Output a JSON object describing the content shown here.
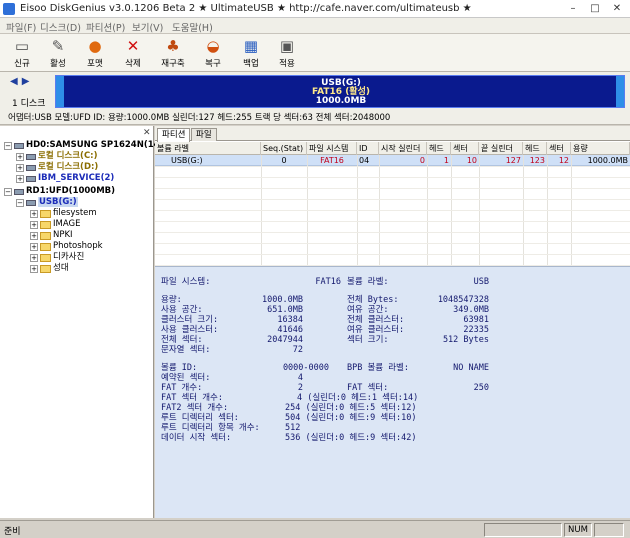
{
  "window": {
    "title": "Eisoo DiskGenius v3.0.1206 Beta 2 ★ UltimateUSB ★ http://cafe.naver.com/ultimateusb ★",
    "minimize": "–",
    "maximize": "□",
    "close": "✕"
  },
  "menu": [
    "파일(F)",
    "디스크(D)",
    "파티션(P)",
    "보기(V)",
    "도움말(H)"
  ],
  "toolbar": [
    {
      "label": "신규",
      "icon": "new-icon",
      "glyph": "▭",
      "color": "#555555"
    },
    {
      "label": "활성",
      "icon": "activate-icon",
      "glyph": "✎",
      "color": "#555555"
    },
    {
      "label": "포맷",
      "icon": "format-icon",
      "glyph": "●",
      "color": "#e06a10"
    },
    {
      "label": "삭제",
      "icon": "delete-icon",
      "glyph": "✕",
      "color": "#d01010"
    },
    {
      "label": "재구축",
      "icon": "rebuild-icon",
      "glyph": "♣",
      "color": "#c04a10"
    },
    {
      "label": "복구",
      "icon": "recover-icon",
      "glyph": "◒",
      "color": "#d05010"
    },
    {
      "label": "백업",
      "icon": "backup-icon",
      "glyph": "▦",
      "color": "#2a5ec0"
    },
    {
      "label": "적용",
      "icon": "apply-icon",
      "glyph": "▣",
      "color": "#555555"
    }
  ],
  "disk_bar": {
    "nav_prev": "◀",
    "nav_next": "▶",
    "disk_label": "1 디스크",
    "partition_name": "USB(G:)",
    "partition_fs": "FAT16 (활성)",
    "partition_size": "1000.0MB"
  },
  "info_line": "어댑터:USB 모델:UFD ID: 용량:1000.0MB 실린더:127 헤드:255 트랙 당 섹터:63 전체 섹터:2048000",
  "tree": {
    "close": "✕",
    "items": [
      {
        "text": "HD0:SAMSUNG SP1624N(149GB)",
        "style": "bold",
        "level": 0,
        "kind": "disk",
        "expander": "−"
      },
      {
        "text": "로컬 디스크(C:)",
        "style": "olive",
        "level": 1,
        "kind": "disk",
        "expander": "+"
      },
      {
        "text": "로컬 디스크(D:)",
        "style": "olive",
        "level": 1,
        "kind": "disk",
        "expander": "+"
      },
      {
        "text": "IBM_SERVICE(2)",
        "style": "blue",
        "level": 1,
        "kind": "disk",
        "expander": "+"
      },
      {
        "text": "RD1:UFD(1000MB)",
        "style": "bold",
        "level": 0,
        "kind": "disk",
        "expander": "−"
      },
      {
        "text": "USB(G:)",
        "style": "sel",
        "level": 1,
        "kind": "disk",
        "expander": "−"
      },
      {
        "text": "filesystem",
        "style": "",
        "level": 2,
        "kind": "folder",
        "expander": "+"
      },
      {
        "text": "IMAGE",
        "style": "",
        "level": 2,
        "kind": "folder",
        "expander": "+"
      },
      {
        "text": "NPKI",
        "style": "",
        "level": 2,
        "kind": "folder",
        "expander": "+"
      },
      {
        "text": "Photoshopk",
        "style": "",
        "level": 2,
        "kind": "folder",
        "expander": "+"
      },
      {
        "text": "디카사진",
        "style": "",
        "level": 2,
        "kind": "folder",
        "expander": "+"
      },
      {
        "text": "성대",
        "style": "",
        "level": 2,
        "kind": "folder",
        "expander": "+"
      }
    ]
  },
  "tabs": [
    "파티션",
    "파일"
  ],
  "table": {
    "headers": [
      "볼륨 라벨",
      "Seq.(Stat)",
      "파일 시스템",
      "ID",
      "시작 실린더",
      "헤드",
      "섹터",
      "끝 실린더",
      "헤드",
      "섹터",
      "용량"
    ],
    "row": [
      "USB(G:)",
      "0",
      "FAT16",
      "04",
      "0",
      "1",
      "10",
      "127",
      "123",
      "12",
      "1000.0MB"
    ]
  },
  "details": {
    "fs_label": "파일 시스템:",
    "fs_value": "FAT16",
    "vol_label": "볼륨 라벨:",
    "vol_value": "USB",
    "capacity_label": "용량:",
    "capacity_value": "1000.0MB",
    "total_label": "전체 Bytes:",
    "total_value": "1048547328",
    "used_label": "사용 공간:",
    "used_value": "651.0MB",
    "free_label": "여유 공간:",
    "free_value": "349.0MB",
    "cluster_size_label": "클러스터 크기:",
    "cluster_size_value": "16384",
    "total_clusters_label": "전체 클러스터:",
    "total_clusters_value": "63981",
    "used_clusters_label": "사용 클러스터:",
    "used_clusters_value": "41646",
    "free_clusters_label": "여유 클러스터:",
    "free_clusters_value": "22335",
    "total_sectors_label": "전체 섹터:",
    "total_sectors_value": "2047944",
    "sector_size_label": "섹터 크기:",
    "sector_size_value": "512 Bytes",
    "bad_sectors_label": "문자열 섹터:",
    "bad_sectors_value": "72",
    "volume_id_label": "볼륨 ID:",
    "volume_id_value": "0000-0000",
    "bpb_label": "BPB 볼륨 라벨:",
    "bpb_value": "NO NAME",
    "reserved_label": "예약된 섹터:",
    "reserved_value": "4",
    "fat_count_label": "FAT 개수:",
    "fat_count_value": "2",
    "fat_sectors_label": "FAT 섹터:",
    "fat_sectors_value": "250",
    "fat_sector_count_label": "FAT 섹터 개수:",
    "fat_sector_count_value": "4 (실린더:0 헤드:1 섹터:14)",
    "fat2_label": "FAT2 섹터 개수:",
    "fat2_value": "254 (실린더:0 헤드:5 섹터:12)",
    "root_dir_label": "루트 디렉터리 섹터:",
    "root_dir_value": "504 (실린더:0 헤드:9 섹터:10)",
    "root_entries_label": "루트 디렉터리 항목 개수:",
    "root_entries_value": "512",
    "data_start_label": "데이터 시작 섹터:",
    "data_start_value": "536 (실린더:0 헤드:9 섹터:42)"
  },
  "status": {
    "text": "준비",
    "num": "NUM"
  }
}
